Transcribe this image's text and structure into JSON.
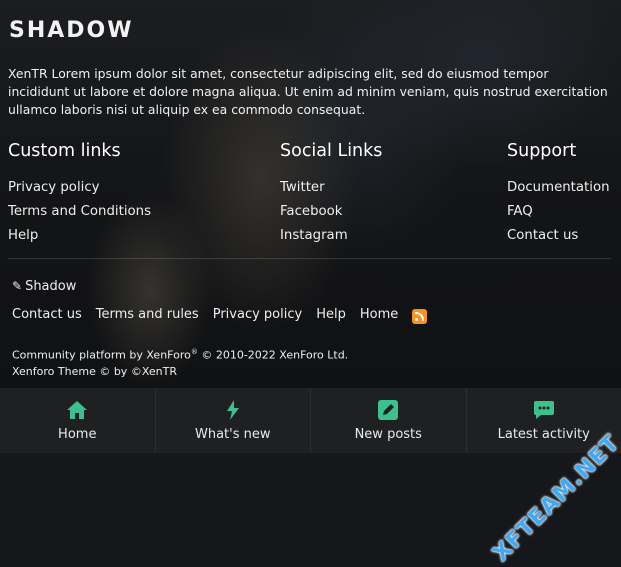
{
  "brand": {
    "logo": "SHADOW"
  },
  "about": "XenTR Lorem ipsum dolor sit amet, consectetur adipiscing elit, sed do eiusmod tempor incididunt ut labore et dolore magna aliqua. Ut enim ad minim veniam, quis nostrud exercitation ullamco laboris nisi ut aliquip ex ea commodo consequat.",
  "columns": [
    {
      "title": "Custom links",
      "items": [
        "Privacy policy",
        "Terms and Conditions",
        "Help"
      ]
    },
    {
      "title": "Social Links",
      "items": [
        "Twitter",
        "Facebook",
        "Instagram"
      ]
    },
    {
      "title": "Support",
      "items": [
        "Documentation",
        "FAQ",
        "Contact us"
      ]
    }
  ],
  "footer": {
    "style_name": "Shadow",
    "links": [
      "Contact us",
      "Terms and rules",
      "Privacy policy",
      "Help",
      "Home"
    ],
    "copyright_line1_a": "Community platform by XenForo",
    "copyright_line1_b": "© 2010-2022 XenForo Ltd.",
    "copyright_line2": "Xenforo Theme © by ©XenTR",
    "rss_icon": "rss-icon"
  },
  "bottom_nav": [
    {
      "label": "Home",
      "icon": "home-icon"
    },
    {
      "label": "What's new",
      "icon": "bolt-icon"
    },
    {
      "label": "New posts",
      "icon": "edit-icon"
    },
    {
      "label": "Latest activity",
      "icon": "chat-icon"
    }
  ],
  "watermark": "XFTEAM.NET",
  "colors": {
    "accent": "#3dbf8e",
    "rss": "#f7931e",
    "watermark": "#3fa9f5"
  }
}
